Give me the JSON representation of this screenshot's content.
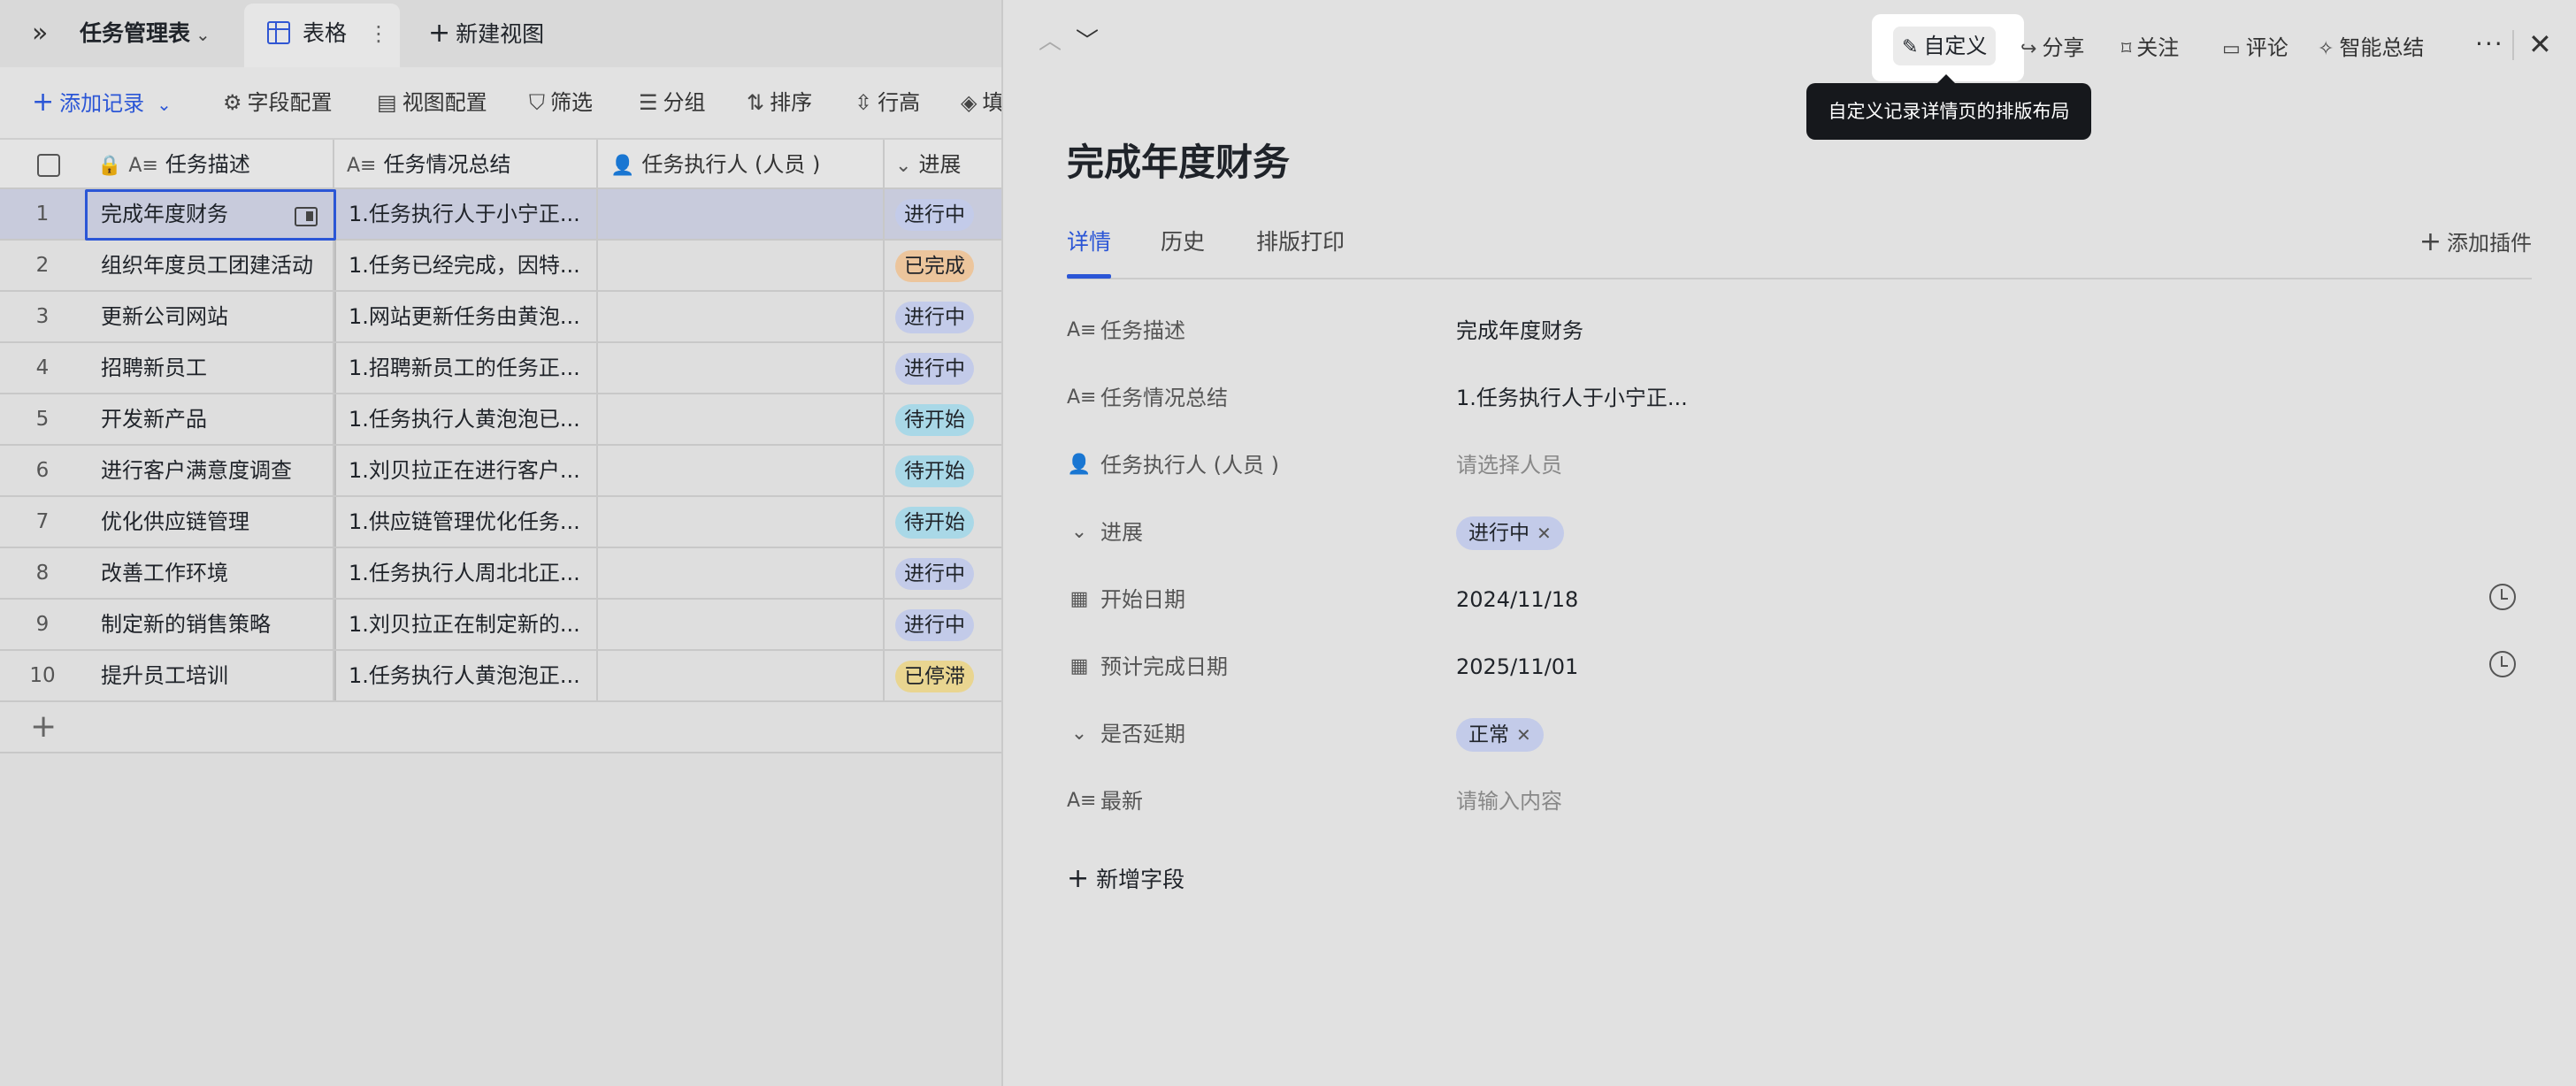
{
  "app": {
    "table_name": "任务管理表",
    "active_view_label": "表格",
    "new_view_label": "新建视图"
  },
  "toolbar": {
    "add_record": "添加记录",
    "field_config": "字段配置",
    "view_config": "视图配置",
    "filter": "筛选",
    "group": "分组",
    "sort": "排序",
    "row_height": "行高",
    "fill_partial": "填"
  },
  "grid": {
    "headers": [
      "任务描述",
      "任务情况总结",
      "任务执行人 (人员 )",
      "进展"
    ],
    "rows": [
      {
        "num": "1",
        "desc": "完成年度财务",
        "summary": "1.任务执行人于小宁正...",
        "progress": "进行中"
      },
      {
        "num": "2",
        "desc": "组织年度员工团建活动",
        "summary": "1.任务已经完成，因特...",
        "progress": "已完成"
      },
      {
        "num": "3",
        "desc": "更新公司网站",
        "summary": "1.网站更新任务由黄泡...",
        "progress": "进行中"
      },
      {
        "num": "4",
        "desc": "招聘新员工",
        "summary": "1.招聘新员工的任务正...",
        "progress": "进行中"
      },
      {
        "num": "5",
        "desc": "开发新产品",
        "summary": "1.任务执行人黄泡泡已...",
        "progress": "待开始"
      },
      {
        "num": "6",
        "desc": "进行客户满意度调查",
        "summary": "1.刘贝拉正在进行客户...",
        "progress": "待开始"
      },
      {
        "num": "7",
        "desc": "优化供应链管理",
        "summary": "1.供应链管理优化任务...",
        "progress": "待开始"
      },
      {
        "num": "8",
        "desc": "改善工作环境",
        "summary": "1.任务执行人周北北正...",
        "progress": "进行中"
      },
      {
        "num": "9",
        "desc": "制定新的销售策略",
        "summary": "1.刘贝拉正在制定新的...",
        "progress": "进行中"
      },
      {
        "num": "10",
        "desc": "提升员工培训",
        "summary": "1.任务执行人黄泡泡正...",
        "progress": "已停滞"
      }
    ]
  },
  "status_colors": {
    "进行中": "#c3cbe9",
    "已完成": "#ecc59c",
    "待开始": "#a9d8e7",
    "已停滞": "#e9d590",
    "正常": "#c3cbe9"
  },
  "panel": {
    "customize": "自定义",
    "share": "分享",
    "follow": "关注",
    "comment": "评论",
    "ai_summary": "智能总结",
    "more": "···",
    "tooltip": "自定义记录详情页的排版布局",
    "record_title": "完成年度财务",
    "tabs": [
      "详情",
      "历史",
      "排版打印"
    ],
    "add_plugin": "添加插件",
    "new_field": "新增字段",
    "fields": {
      "desc": {
        "label": "任务描述",
        "value": "完成年度财务"
      },
      "summary": {
        "label": "任务情况总结",
        "value": "1.任务执行人于小宁正..."
      },
      "executor": {
        "label": "任务执行人 (人员 )",
        "placeholder": "请选择人员"
      },
      "progress": {
        "label": "进展",
        "value": "进行中"
      },
      "start_date": {
        "label": "开始日期",
        "value": "2024/11/18"
      },
      "due_date": {
        "label": "预计完成日期",
        "value": "2025/11/01"
      },
      "delayed": {
        "label": "是否延期",
        "value": "正常"
      },
      "latest": {
        "label": "最新",
        "placeholder": "请输入内容"
      }
    }
  }
}
